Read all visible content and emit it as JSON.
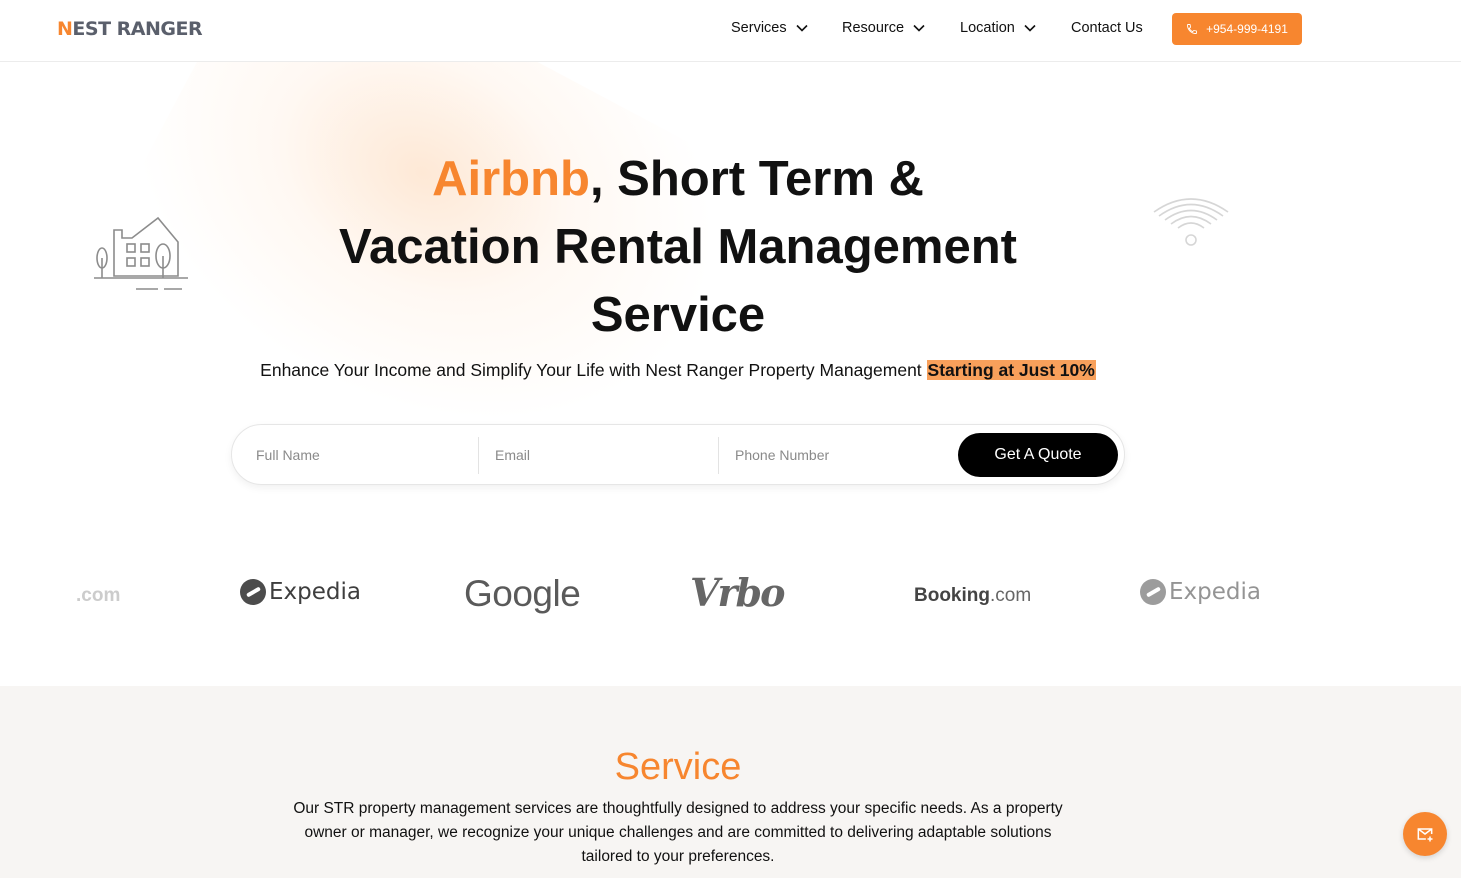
{
  "header": {
    "logo_text_prefix": "N",
    "logo_text_rest": "EST RANGER",
    "nav": [
      {
        "label": "Services"
      },
      {
        "label": "Resource"
      },
      {
        "label": "Location"
      },
      {
        "label": "Contact Us"
      }
    ],
    "phone_label": "+954-999-4191"
  },
  "hero": {
    "title_accent": "Airbnb",
    "title_line1_rest": ", Short Term &",
    "title_line2": "Vacation Rental Management",
    "title_line3": "Service",
    "subline_text": "Enhance Your Income and Simplify Your Life with Nest Ranger Property Management ",
    "subline_highlight": "Starting at Just 10%"
  },
  "form": {
    "full_name_placeholder": "Full Name",
    "email_placeholder": "Email",
    "phone_placeholder": "Phone Number",
    "submit_label": "Get A Quote"
  },
  "brands": {
    "partial_com": ".com",
    "expedia": "Expedia",
    "google": "Google",
    "vrbo": "Vrbo",
    "booking_main": "Booking",
    "booking_suffix": ".com",
    "expedia_2": "Expedia"
  },
  "service": {
    "title": "Service",
    "description": "Our STR property management services are thoughtfully designed to address your specific needs. As a property owner or manager, we recognize your unique challenges and are committed to delivering adaptable solutions tailored to your preferences."
  },
  "colors": {
    "accent": "#f7862f",
    "highlight": "#f8a05b",
    "button_dark": "#000000",
    "section_bg": "#f7f5f3"
  },
  "icons": {
    "phone": "phone-icon",
    "chevron": "chevron-down-icon",
    "house": "house-icon",
    "wifi": "wifi-icon",
    "mail": "mail-icon"
  }
}
